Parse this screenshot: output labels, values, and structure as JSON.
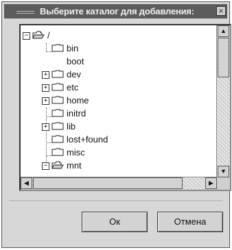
{
  "window": {
    "title": "Выберите каталог для добавления:",
    "close_glyph": "×"
  },
  "tree": {
    "items": [
      {
        "label": "/",
        "expander": "−",
        "icon": "open-folder-icon"
      },
      {
        "label": "bin",
        "expander": "",
        "icon": "folder-icon"
      },
      {
        "label": "boot",
        "expander": "",
        "icon": ""
      },
      {
        "label": "dev",
        "expander": "+",
        "icon": "folder-icon"
      },
      {
        "label": "etc",
        "expander": "+",
        "icon": "folder-icon"
      },
      {
        "label": "home",
        "expander": "+",
        "icon": "folder-icon"
      },
      {
        "label": "initrd",
        "expander": "",
        "icon": "folder-icon"
      },
      {
        "label": "lib",
        "expander": "+",
        "icon": "folder-icon"
      },
      {
        "label": "lost+found",
        "expander": "",
        "icon": "folder-icon"
      },
      {
        "label": "misc",
        "expander": "",
        "icon": "folder-icon"
      },
      {
        "label": "mnt",
        "expander": "−",
        "icon": "open-folder-icon"
      }
    ]
  },
  "scroll": {
    "up": "▲",
    "down": "▼",
    "left": "◀",
    "right": "▶"
  },
  "buttons": {
    "ok": "Ок",
    "cancel": "Отмена"
  }
}
